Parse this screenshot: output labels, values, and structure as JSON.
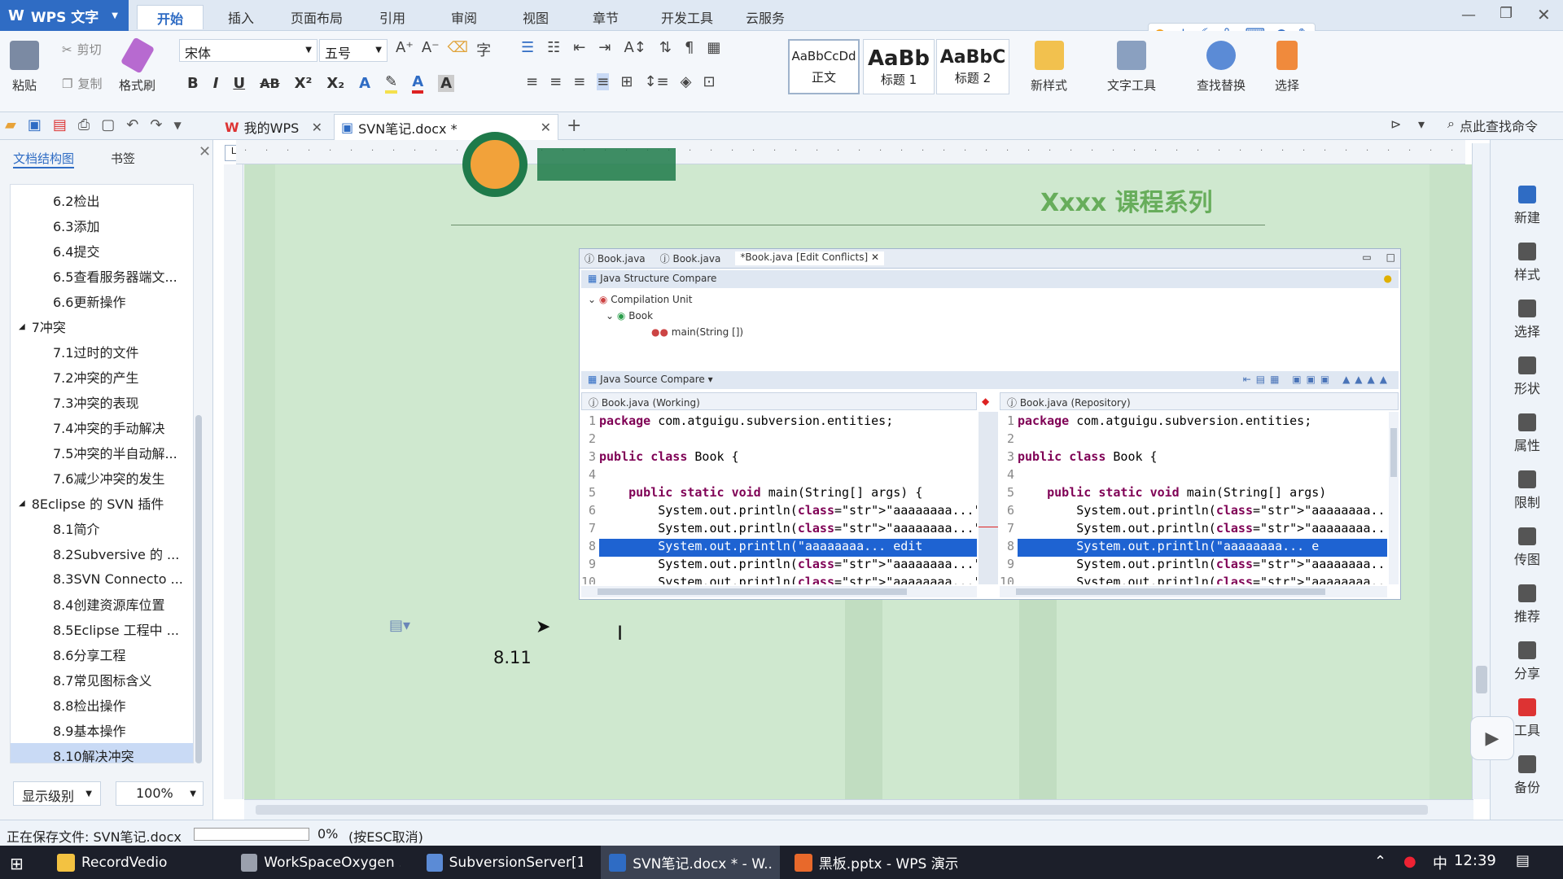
{
  "app": {
    "name": "WPS 文字",
    "brand_color": "#2f6cc4"
  },
  "menu": {
    "tabs": [
      "开始",
      "插入",
      "页面布局",
      "引用",
      "审阅",
      "视图",
      "章节",
      "开发工具",
      "云服务"
    ],
    "active": "开始"
  },
  "ribbon": {
    "paste": "粘贴",
    "cut": "剪切",
    "copy": "复制",
    "format_painter": "格式刷",
    "font_name": "宋体",
    "font_size": "五号",
    "styles": [
      {
        "preview": "AaBbCcDd",
        "name": "正文"
      },
      {
        "preview": "AaBb",
        "name": "标题 1"
      },
      {
        "preview": "AaBbC",
        "name": "标题 2"
      }
    ],
    "new_style": "新样式",
    "text_tools": "文字工具",
    "find_replace": "查找替换",
    "select": "选择"
  },
  "doc_tabs": [
    {
      "label": "我的WPS"
    },
    {
      "label": "SVN笔记.docx *"
    }
  ],
  "quick_search": "点此查找命令",
  "left_panel": {
    "tab_outline": "文档结构图",
    "tab_bookmarks": "书签",
    "items": [
      {
        "label": "6.2检出",
        "level": 2
      },
      {
        "label": "6.3添加",
        "level": 2
      },
      {
        "label": "6.4提交",
        "level": 2
      },
      {
        "label": "6.5查看服务器端文...",
        "level": 2
      },
      {
        "label": "6.6更新操作",
        "level": 2
      },
      {
        "label": "7冲突",
        "level": 1
      },
      {
        "label": "7.1过时的文件",
        "level": 2
      },
      {
        "label": "7.2冲突的产生",
        "level": 2
      },
      {
        "label": "7.3冲突的表现",
        "level": 2
      },
      {
        "label": "7.4冲突的手动解决",
        "level": 2
      },
      {
        "label": "7.5冲突的半自动解...",
        "level": 2
      },
      {
        "label": "7.6减少冲突的发生",
        "level": 2
      },
      {
        "label": "8Eclipse 的 SVN 插件",
        "level": 1
      },
      {
        "label": "8.1简介",
        "level": 2
      },
      {
        "label": "8.2Subversive 的 ...",
        "level": 2
      },
      {
        "label": "8.3SVN Connecto ...",
        "level": 2
      },
      {
        "label": "8.4创建资源库位置",
        "level": 2
      },
      {
        "label": "8.5Eclipse 工程中 ...",
        "level": 2
      },
      {
        "label": "8.6分享工程",
        "level": 2
      },
      {
        "label": "8.7常见图标含义",
        "level": 2
      },
      {
        "label": "8.8检出操作",
        "level": 2
      },
      {
        "label": "8.9基本操作",
        "level": 2
      },
      {
        "label": "8.10解决冲突",
        "level": 2,
        "selected": true
      }
    ],
    "display_level": "显示级别",
    "zoom": "100%"
  },
  "document": {
    "header_text": "Xxxx 课程系列",
    "heading": "8.11",
    "screenshot": {
      "tabs": [
        "Book.java",
        "Book.java",
        "*Book.java [Edit Conflicts]"
      ],
      "structure_title": "Java Structure Compare",
      "tree": [
        "Compilation Unit",
        "Book",
        "main(String [])"
      ],
      "source_title": "Java Source Compare",
      "left_title": "Book.java (Working)",
      "right_title": "Book.java (Repository)",
      "left_lines": [
        {
          "n": "1",
          "t": "package com.atguigu.subversion.entities;"
        },
        {
          "n": "2",
          "t": ""
        },
        {
          "n": "3",
          "t": "public class Book {"
        },
        {
          "n": "4",
          "t": ""
        },
        {
          "n": "5",
          "t": "    public static void main(String[] args) {"
        },
        {
          "n": "6",
          "t": "        System.out.println(\"aaaaaaaa...\");"
        },
        {
          "n": "7",
          "t": "        System.out.println(\"aaaaaaaa...\");"
        },
        {
          "n": "8",
          "t": "        System.out.println(\"aaaaaaaa... edit"
        },
        {
          "n": "9",
          "t": "        System.out.println(\"aaaaaaaa...\");"
        },
        {
          "n": "10",
          "t": "        System.out.println(\"aaaaaaaa...\");"
        }
      ],
      "right_lines": [
        {
          "n": "1",
          "t": "package com.atguigu.subversion.entities;"
        },
        {
          "n": "2",
          "t": ""
        },
        {
          "n": "3",
          "t": "public class Book {"
        },
        {
          "n": "4",
          "t": ""
        },
        {
          "n": "5",
          "t": "    public static void main(String[] args)"
        },
        {
          "n": "6",
          "t": "        System.out.println(\"aaaaaaaa...\")"
        },
        {
          "n": "7",
          "t": "        System.out.println(\"aaaaaaaa...\")"
        },
        {
          "n": "8",
          "t": "        System.out.println(\"aaaaaaaa... e"
        },
        {
          "n": "9",
          "t": "        System.out.println(\"aaaaaaaa...\")"
        },
        {
          "n": "10",
          "t": "        System.out.println(\"aaaaaaaa...\")"
        }
      ],
      "highlighted_line": 8
    }
  },
  "right_bar": [
    "新建",
    "样式",
    "选择",
    "形状",
    "属性",
    "限制",
    "传图",
    "推荐",
    "分享",
    "工具",
    "备份"
  ],
  "status": {
    "saving": "正在保存文件: SVN笔记.docx",
    "percent": "0%",
    "hint": "(按ESC取消)",
    "progress": 0
  },
  "taskbar": {
    "items": [
      {
        "label": "RecordVedio",
        "color": "#f3c241"
      },
      {
        "label": "WorkSpaceOxygen ...",
        "color": "#9aa0ad"
      },
      {
        "label": "SubversionServer[1...",
        "color": "#5b8bd6"
      },
      {
        "label": "SVN笔记.docx * - W...",
        "color": "#2f6cc4",
        "active": true
      },
      {
        "label": "黑板.pptx - WPS 演示",
        "color": "#e8692b"
      }
    ],
    "ime": "中",
    "time": "12:39"
  }
}
